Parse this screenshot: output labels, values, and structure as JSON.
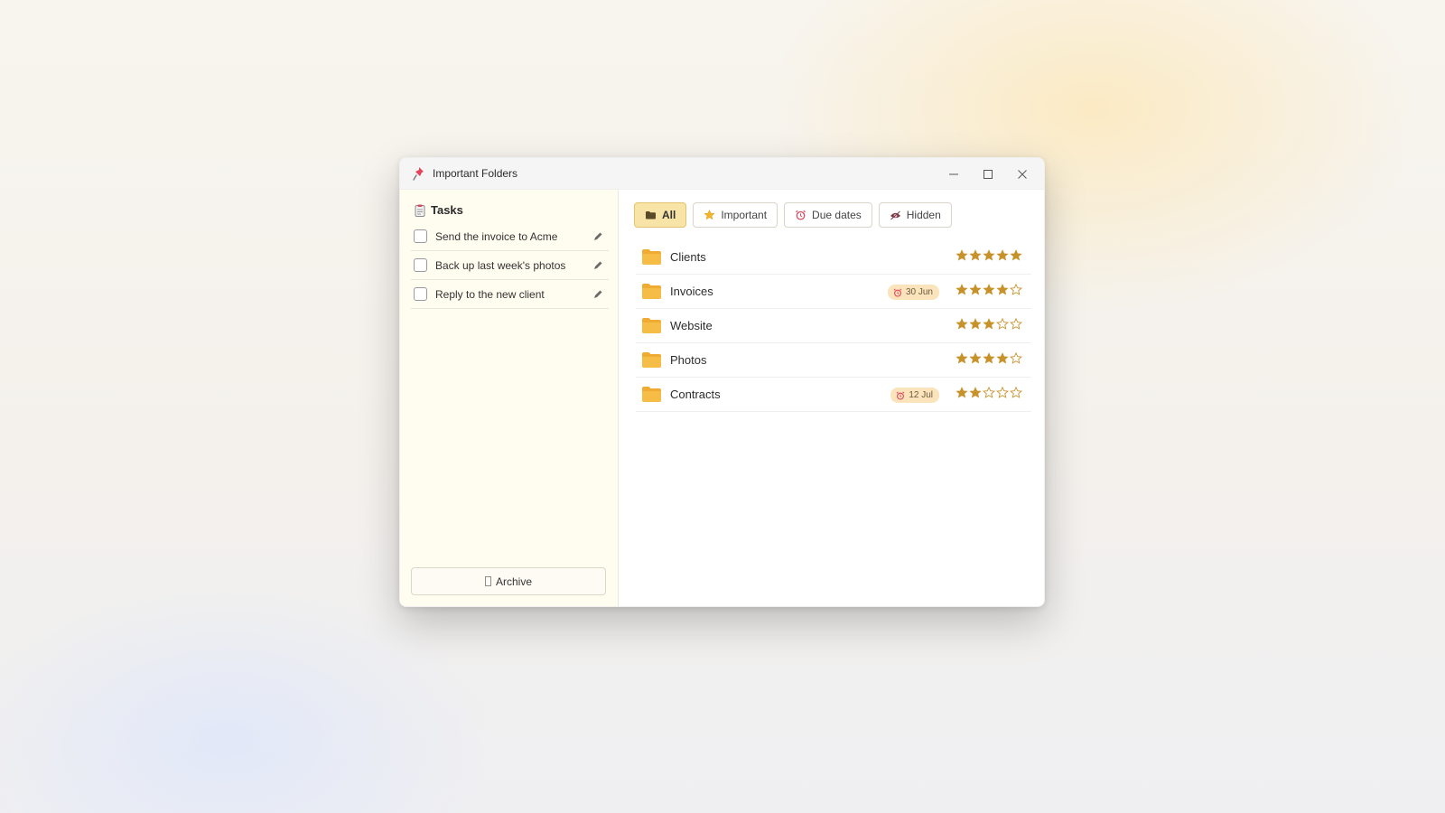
{
  "window": {
    "title": "Important Folders",
    "controls": [
      "minimize",
      "maximize",
      "close"
    ]
  },
  "sidebar": {
    "heading": "Tasks",
    "tasks": [
      {
        "label": "Send the invoice to Acme",
        "checked": false
      },
      {
        "label": "Back up last week's photos",
        "checked": false
      },
      {
        "label": "Reply to the new client",
        "checked": false
      }
    ],
    "archive_label": "Archive"
  },
  "filters": [
    {
      "label": "All",
      "icon": "folder-icon",
      "active": true
    },
    {
      "label": "Important",
      "icon": "star-icon",
      "active": false
    },
    {
      "label": "Due dates",
      "icon": "alarm-clock-icon",
      "active": false
    },
    {
      "label": "Hidden",
      "icon": "hidden-icon",
      "active": false
    }
  ],
  "folders": [
    {
      "name": "Clients",
      "due": null,
      "rating": 5
    },
    {
      "name": "Invoices",
      "due": "30 Jun",
      "rating": 4
    },
    {
      "name": "Website",
      "due": null,
      "rating": 3
    },
    {
      "name": "Photos",
      "due": null,
      "rating": 4
    },
    {
      "name": "Contracts",
      "due": "12 Jul",
      "rating": 2
    }
  ],
  "rating_max": 5,
  "colors": {
    "accent": "#f8e4a6",
    "folder": "#f3b43a",
    "star": "#c7922a",
    "badge": "#fbe3bb",
    "alarm": "#d84a5f",
    "sidebar_bg": "#fffcf0"
  }
}
